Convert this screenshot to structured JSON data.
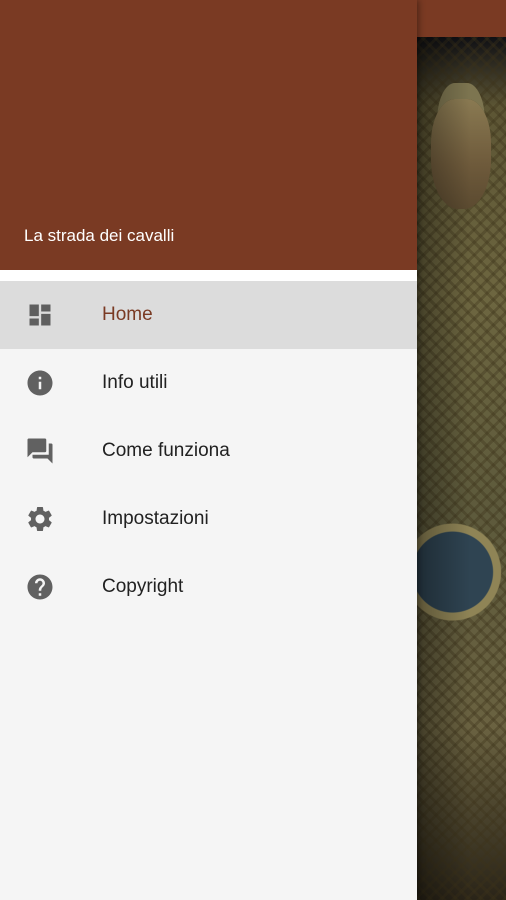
{
  "drawer": {
    "title": "La strada dei cavalli",
    "items": [
      {
        "label": "Home",
        "icon": "dashboard-icon",
        "active": true
      },
      {
        "label": "Info utili",
        "icon": "info-icon",
        "active": false
      },
      {
        "label": "Come funziona",
        "icon": "forum-icon",
        "active": false
      },
      {
        "label": "Impostazioni",
        "icon": "settings-gear-icon",
        "active": false
      },
      {
        "label": "Copyright",
        "icon": "help-icon",
        "active": false
      }
    ]
  },
  "colors": {
    "header": "#7a3a23",
    "active_label": "#7a3a23",
    "active_row": "#dcdcdc",
    "icon": "#616161",
    "drawer_bg": "#f5f5f5"
  }
}
